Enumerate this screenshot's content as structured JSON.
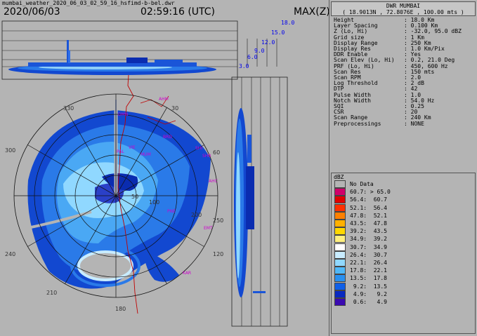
{
  "header": {
    "filename": "mumbai_weather_2020_06_03_02_59_16_hsfimd-b-bel.dwr",
    "date": "2020/06/03",
    "time": "02:59:16 (UTC)",
    "product": "MAX(Z)"
  },
  "station": {
    "name": "DWR MUMBAI",
    "coords": "( 18.9013N , 72.8076E , 100.00 mts )"
  },
  "params": [
    {
      "key": "Height",
      "value": ": 18.0 Km"
    },
    {
      "key": "Layer Spacing",
      "value": ": 0.100 Km"
    },
    {
      "key": "Z (Lo, Hi)",
      "value": ": -32.0, 95.0 dBZ"
    },
    {
      "key": "Grid size",
      "value": ": 1 Km"
    },
    {
      "key": "Display Range",
      "value": ": 250 Km"
    },
    {
      "key": "Display Res",
      "value": ": 1.0 Km/Pix"
    },
    {
      "key": "DDR Enable",
      "value": ": Yes"
    },
    {
      "key": "Scan Elev (Lo, Hi)",
      "value": ": 0.2, 21.0 Deg"
    },
    {
      "key": "PRF (Lo, Hi)",
      "value": ": 450, 600 Hz"
    },
    {
      "key": "Scan Res",
      "value": ": 150 mts"
    },
    {
      "key": "Scan RPM",
      "value": ": 2.0"
    },
    {
      "key": "Log Threshold",
      "value": ": 2 dB"
    },
    {
      "key": "DTP",
      "value": ": 42"
    },
    {
      "key": "Pulse Width",
      "value": ": 1.0"
    },
    {
      "key": "Notch Width",
      "value": ": 54.0 Hz"
    },
    {
      "key": "SQI",
      "value": ": 0.25"
    },
    {
      "key": "CSR",
      "value": ": 20"
    },
    {
      "key": "Scan Range",
      "value": ": 240 Km"
    },
    {
      "key": "Preprocessings",
      "value": ": NONE"
    }
  ],
  "legend": {
    "unit": "dBZ",
    "items": [
      {
        "label": "No Data",
        "color": "#b4b4b4"
      },
      {
        "label": "60.7: > 65.0",
        "color": "#d0006a"
      },
      {
        "label": "56.4:  60.7",
        "color": "#e00000"
      },
      {
        "label": "52.1:  56.4",
        "color": "#ff3000"
      },
      {
        "label": "47.8:  52.1",
        "color": "#ff8000"
      },
      {
        "label": "43.5:  47.8",
        "color": "#ffb000"
      },
      {
        "label": "39.2:  43.5",
        "color": "#ffd800"
      },
      {
        "label": "34.9:  39.2",
        "color": "#fff080"
      },
      {
        "label": "30.7:  34.9",
        "color": "#ffffff"
      },
      {
        "label": "26.4:  30.7",
        "color": "#c8ecff"
      },
      {
        "label": "22.1:  26.4",
        "color": "#90d8ff"
      },
      {
        "label": "17.8:  22.1",
        "color": "#50b8f8"
      },
      {
        "label": "13.5:  17.8",
        "color": "#2890f0"
      },
      {
        "label": " 9.2:  13.5",
        "color": "#1060e8"
      },
      {
        "label": " 4.9:   9.2",
        "color": "#0828c0"
      },
      {
        "label": " 0.6:   4.9",
        "color": "#3a0ab0"
      }
    ]
  },
  "height_scale": [
    "18.0",
    "15.0",
    "12.0",
    "9.0",
    "6.0",
    "3.0"
  ],
  "azimuth_labels": [
    "330",
    "30",
    "300",
    "60",
    "240",
    "120",
    "210",
    "180"
  ],
  "range_labels": [
    "50",
    "100",
    "200",
    "250"
  ],
  "sites": [
    "DMN",
    "AHM",
    "BRD",
    "VIE",
    "MUM",
    "SHI",
    "SHR",
    "PAL",
    "AHC",
    "PNE",
    "EMT",
    "KAR"
  ]
}
